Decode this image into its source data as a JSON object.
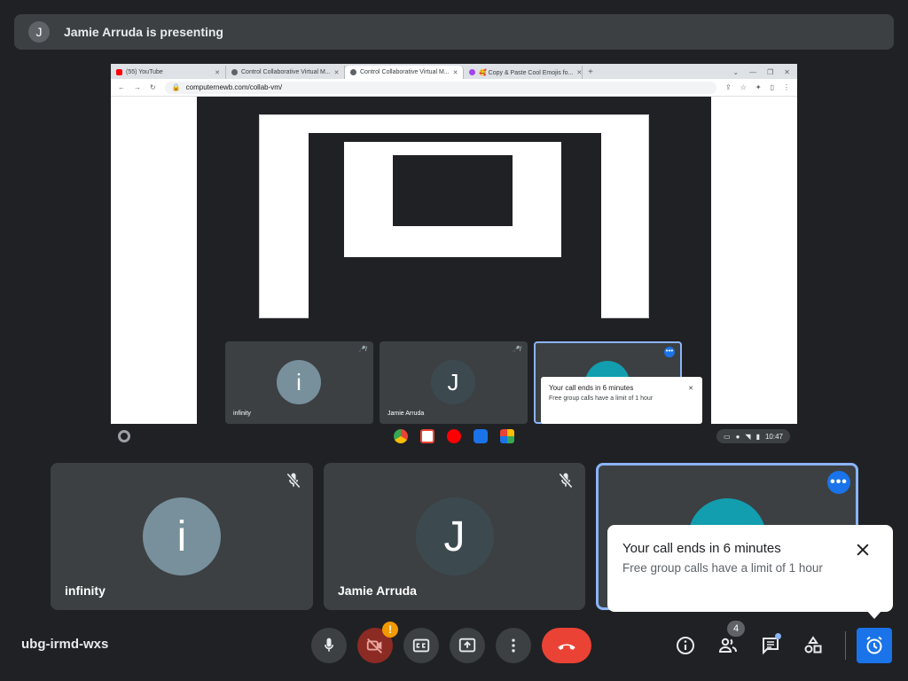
{
  "banner": {
    "avatar": "J",
    "text": "Jamie Arruda is presenting"
  },
  "browser": {
    "tabs": [
      {
        "label": "(55) YouTube",
        "color": "#ff0000"
      },
      {
        "label": "Control Collaborative Virtual M...",
        "color": "#5f6368"
      },
      {
        "label": "Control Collaborative Virtual M...",
        "color": "#5f6368"
      },
      {
        "label": "🥰 Copy & Paste Cool Emojis fo...",
        "color": "#a142f4"
      }
    ],
    "url": "computernewb.com/collab-vm/"
  },
  "mini_tiles": [
    {
      "avatar": "i",
      "name": "infinity"
    },
    {
      "avatar": "J",
      "name": "Jamie Arruda"
    }
  ],
  "mini_toast": {
    "title": "Your call ends in 6 minutes",
    "body": "Free group calls have a limit of 1 hour"
  },
  "mini_clock": "10:47",
  "tiles": [
    {
      "avatar": "i",
      "name": "infinity",
      "avatar_color": "#78909c"
    },
    {
      "avatar": "J",
      "name": "Jamie Arruda",
      "avatar_color": "#3c4a50"
    },
    {
      "avatar_color": "#129eaf"
    }
  ],
  "toast": {
    "title": "Your call ends in 6 minutes",
    "body": "Free group calls have a limit of 1 hour"
  },
  "bottom": {
    "meeting_code": "ubg-irmd-wxs",
    "camera_warning": "!",
    "people_count": "4"
  },
  "colors": {
    "accent": "#1a73e8",
    "end_call": "#ea4335",
    "warning": "#f29900"
  }
}
